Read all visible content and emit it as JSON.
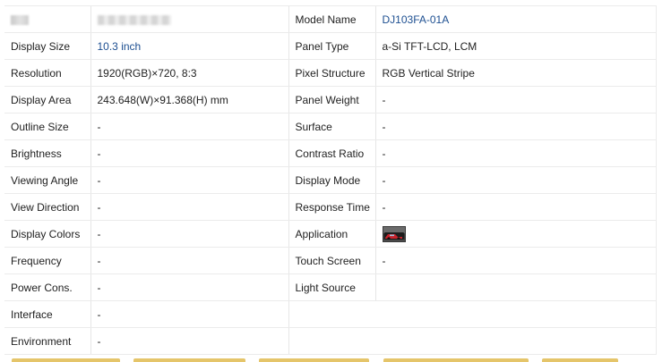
{
  "rows": [
    {
      "label": "",
      "value": "",
      "label2": "Model Name",
      "value2": "DJ103FA-01A"
    },
    {
      "label": "Display Size",
      "value": "10.3 inch",
      "label2": "Panel Type",
      "value2": "a-Si TFT-LCD, LCM"
    },
    {
      "label": "Resolution",
      "value": "1920(RGB)×720, 8:3",
      "label2": "Pixel Structure",
      "value2": "RGB Vertical Stripe"
    },
    {
      "label": "Display Area",
      "value": "243.648(W)×91.368(H) mm",
      "label2": "Panel Weight",
      "value2": "-"
    },
    {
      "label": "Outline Size",
      "value": "-",
      "label2": "Surface",
      "value2": "-"
    },
    {
      "label": "Brightness",
      "value": "-",
      "label2": "Contrast Ratio",
      "value2": "-"
    },
    {
      "label": "Viewing Angle",
      "value": "-",
      "label2": "Display Mode",
      "value2": "-"
    },
    {
      "label": "View Direction",
      "value": "-",
      "label2": "Response Time",
      "value2": "-"
    },
    {
      "label": "Display Colors",
      "value": "-",
      "label2": "Application",
      "value2": ""
    },
    {
      "label": "Frequency",
      "value": "-",
      "label2": "Touch Screen",
      "value2": "-"
    },
    {
      "label": "Power Cons.",
      "value": "-",
      "label2": "Light Source",
      "value2": ""
    },
    {
      "label": "Interface",
      "value": "-"
    },
    {
      "label": "Environment",
      "value": "-"
    }
  ],
  "application_icon": "car-dashboard-thumbnail-icon",
  "colors": {
    "link": "#1d4f91",
    "border": "#ebebeb",
    "tab_accent": "#e5c56a"
  }
}
